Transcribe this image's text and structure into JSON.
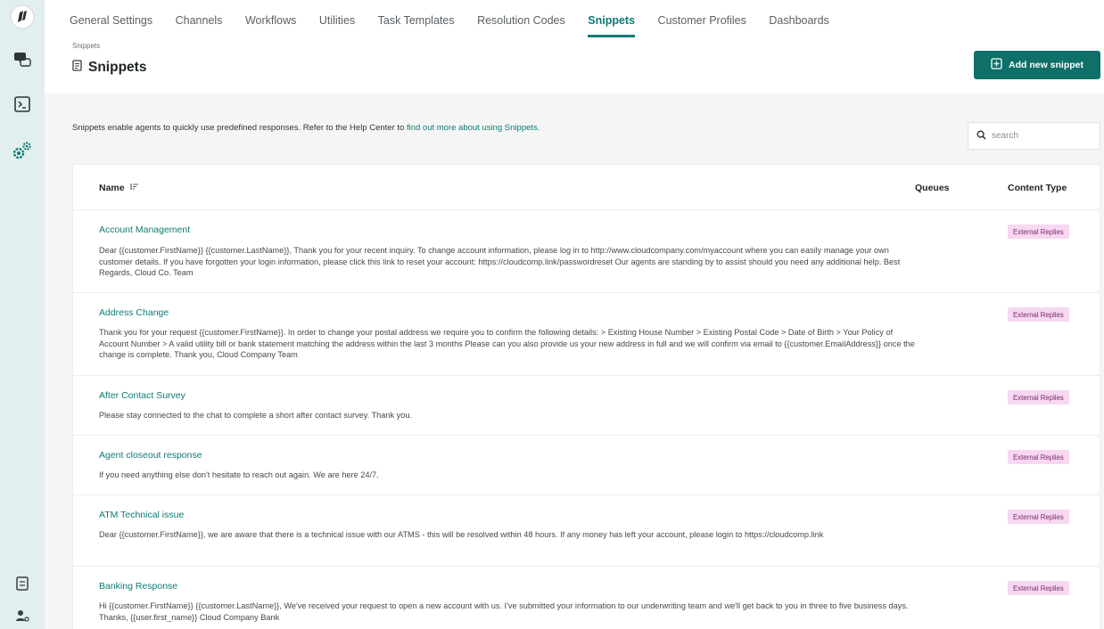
{
  "rail": {
    "icons": [
      "logo-icon",
      "chat-icon",
      "console-icon",
      "settings-gears-icon",
      "notes-icon",
      "user-settings-icon"
    ]
  },
  "tabs": [
    {
      "label": "General Settings",
      "active": false
    },
    {
      "label": "Channels",
      "active": false
    },
    {
      "label": "Workflows",
      "active": false
    },
    {
      "label": "Utilities",
      "active": false
    },
    {
      "label": "Task Templates",
      "active": false
    },
    {
      "label": "Resolution Codes",
      "active": false
    },
    {
      "label": "Snippets",
      "active": true
    },
    {
      "label": "Customer Profiles",
      "active": false
    },
    {
      "label": "Dashboards",
      "active": false
    }
  ],
  "breadcrumb": "Snippets",
  "page_title": "Snippets",
  "add_button_label": "Add new snippet",
  "intro": {
    "text": "Snippets enable agents to quickly use predefined responses. Refer to the Help Center to ",
    "link": "find out more about using Snippets."
  },
  "search": {
    "placeholder": "search",
    "value": ""
  },
  "table": {
    "columns": {
      "name": "Name",
      "queues": "Queues",
      "content_type": "Content Type"
    },
    "rows": [
      {
        "name": "Account Management",
        "body": "Dear {{customer.FirstName}} {{customer.LastName}}, Thank you for your recent inquiry. To change account information, please log in to http://www.cloudcompany.com/myaccount where you can easily manage your own customer details. If you have forgotten your login information, please click this link to reset your account: https://cloudcomp.link/passwordreset Our agents are standing by to assist should you need any additional help. Best Regards, Cloud Co. Team",
        "queues": "",
        "content_type": "External Replies"
      },
      {
        "name": "Address Change",
        "body": "Thank you for your request {{customer.FirstName}}. In order to change your postal address we require you to confirm the following details: > Existing House Number > Existing Postal Code > Date of Birth > Your Policy of Account Number > A valid utility bill or bank statement matching the address within the last 3 months Please can you also provide us your new address in full and we will confirm via email to {{customer.EmailAddress}} once the change is complete. Thank you, Cloud Company Team",
        "queues": "",
        "content_type": "External Replies"
      },
      {
        "name": "After Contact Survey",
        "body": "Please stay connected to the chat to complete a short after contact survey. Thank you.",
        "queues": "",
        "content_type": "External Replies"
      },
      {
        "name": "Agent closeout response",
        "body": "If you need anything else don't hesitate to reach out again. We are here 24/7.",
        "queues": "",
        "content_type": "External Replies"
      },
      {
        "name": "ATM Technical issue",
        "body": "Dear {{customer.FirstName}}, we are aware that there is a technical issue with our ATMS - this will be resolved within 48 hours. If any money has left your account, please login to https://cloudcomp.link",
        "queues": "",
        "content_type": "External Replies"
      },
      {
        "name": "Banking Response",
        "body": "Hi {{customer.FirstName}} {{customer.LastName}}, We've received your request to open a new account with us. I've submitted your information to our underwriting team and we'll get back to you in three to five business days. Thanks, {{user.first_name}} Cloud Company Bank",
        "queues": "",
        "content_type": "External Replies"
      }
    ]
  },
  "colors": {
    "accent": "#0c7b74",
    "button": "#0f6f69",
    "rail": "#e1efef",
    "badge_bg": "#f7d7f1",
    "badge_text": "#7a2c69"
  }
}
